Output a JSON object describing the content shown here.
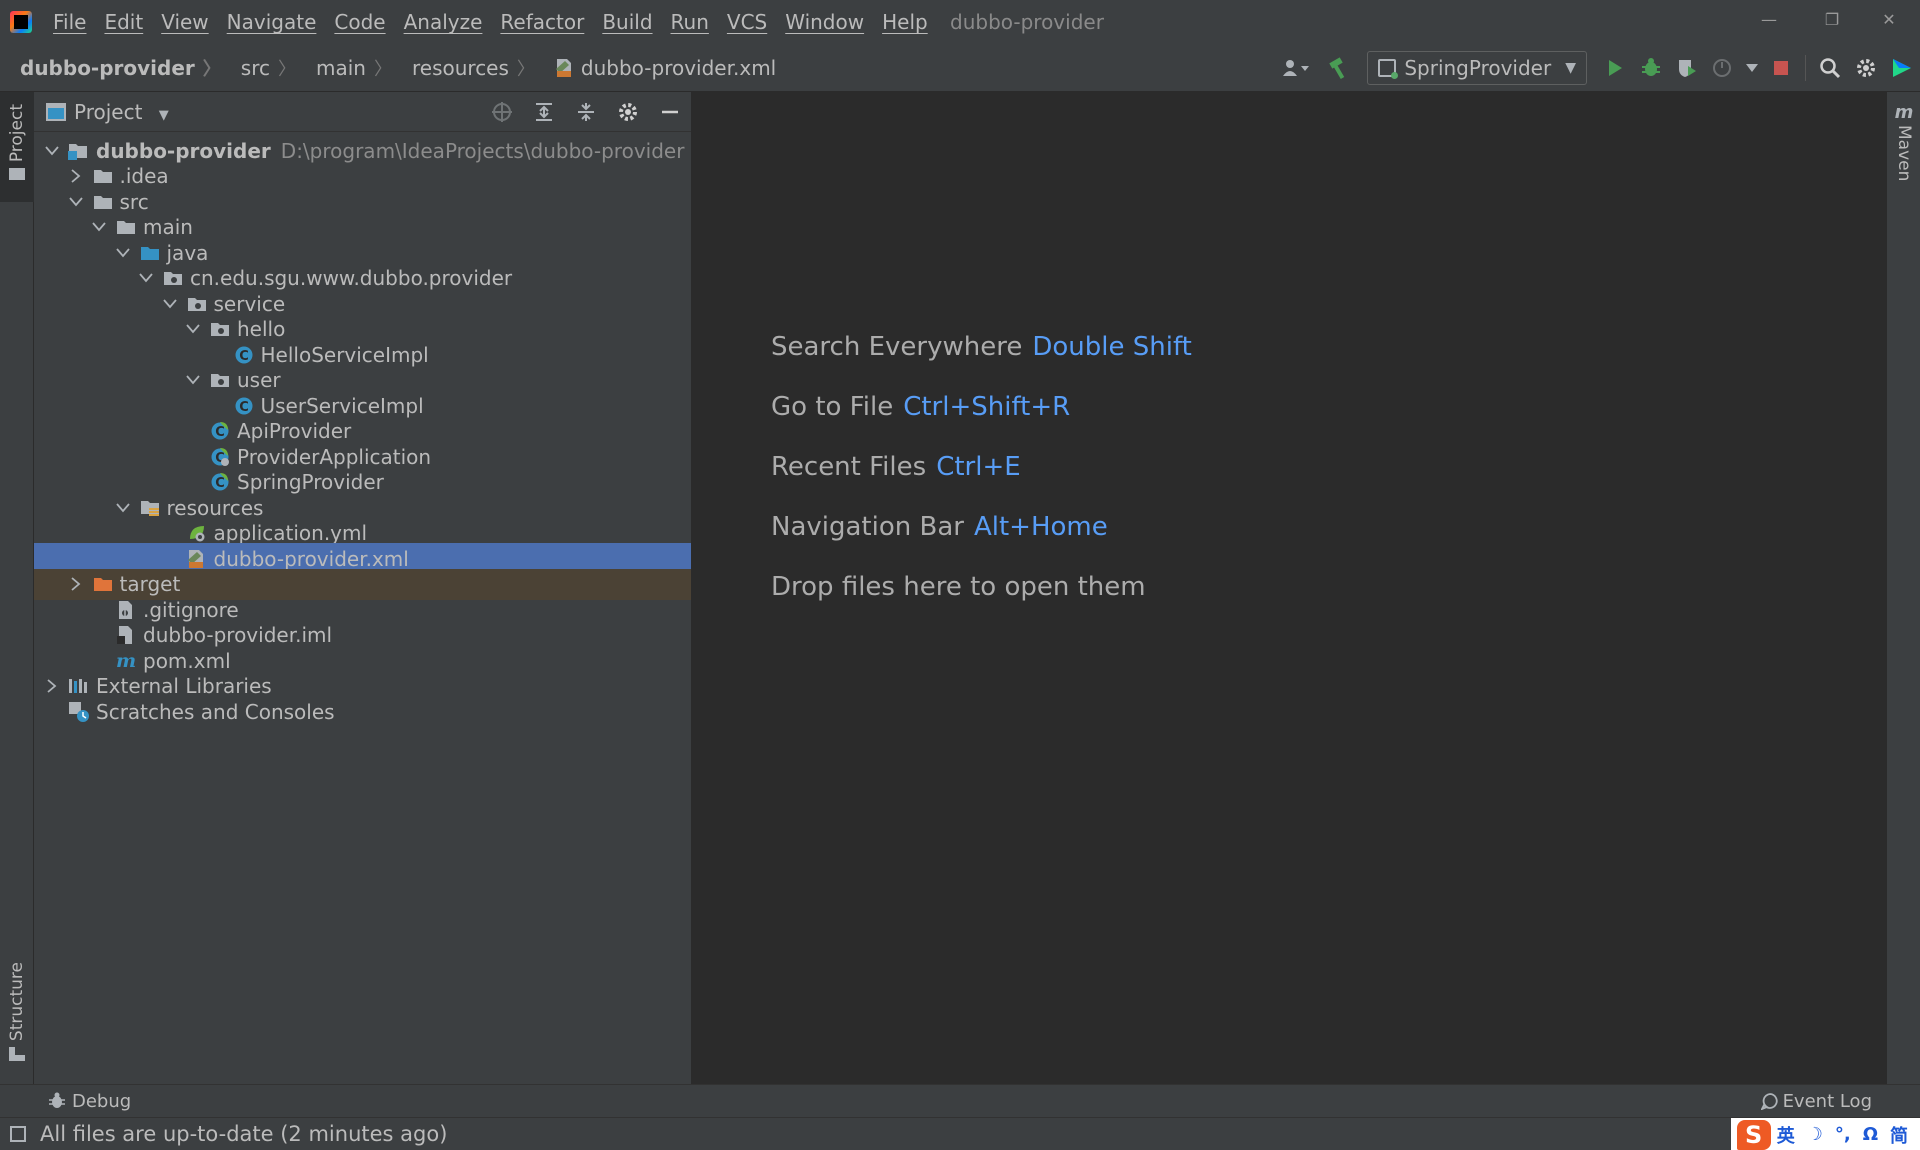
{
  "menu": {
    "items": [
      "File",
      "Edit",
      "View",
      "Navigate",
      "Code",
      "Analyze",
      "Refactor",
      "Build",
      "Run",
      "VCS",
      "Window",
      "Help"
    ],
    "window_title": "dubbo-provider"
  },
  "window_controls": {
    "minimize": "—",
    "restore": "❐",
    "close": "✕"
  },
  "breadcrumb": {
    "items": [
      "dubbo-provider",
      "src",
      "main",
      "resources",
      "dubbo-provider.xml"
    ],
    "separator": "〉"
  },
  "toolbar": {
    "run_config": "SpringProvider",
    "colors": {
      "run": "#499c54",
      "stop": "#c75450",
      "hammer": "#499c54"
    }
  },
  "side_tabs": {
    "project": "Project",
    "structure": "Structure",
    "maven": "Maven"
  },
  "project_panel": {
    "title": "Project",
    "tree": [
      {
        "label": "dubbo-provider",
        "hint": "D:\\program\\IdeaProjects\\dubbo-provider",
        "icon": "module-folder-icon",
        "depth": 0,
        "expanded": true,
        "bold": true
      },
      {
        "label": ".idea",
        "icon": "folder-icon",
        "depth": 1,
        "expanded": false
      },
      {
        "label": "src",
        "icon": "folder-icon",
        "depth": 1,
        "expanded": true
      },
      {
        "label": "main",
        "icon": "folder-icon",
        "depth": 2,
        "expanded": true
      },
      {
        "label": "java",
        "icon": "source-folder-icon",
        "depth": 3,
        "expanded": true
      },
      {
        "label": "cn.edu.sgu.www.dubbo.provider",
        "icon": "package-icon",
        "depth": 4,
        "expanded": true
      },
      {
        "label": "service",
        "icon": "package-icon",
        "depth": 5,
        "expanded": true
      },
      {
        "label": "hello",
        "icon": "package-icon",
        "depth": 6,
        "expanded": true
      },
      {
        "label": "HelloServiceImpl",
        "icon": "class-icon",
        "depth": 7
      },
      {
        "label": "user",
        "icon": "package-icon",
        "depth": 6,
        "expanded": true
      },
      {
        "label": "UserServiceImpl",
        "icon": "class-icon",
        "depth": 7
      },
      {
        "label": "ApiProvider",
        "icon": "spring-class-icon",
        "depth": 6
      },
      {
        "label": "ProviderApplication",
        "icon": "spring-boot-class-icon",
        "depth": 6
      },
      {
        "label": "SpringProvider",
        "icon": "spring-class-icon",
        "depth": 6
      },
      {
        "label": "resources",
        "icon": "resources-folder-icon",
        "depth": 3,
        "expanded": true
      },
      {
        "label": "application.yml",
        "icon": "yml-icon",
        "depth": 5
      },
      {
        "label": "dubbo-provider.xml",
        "icon": "xml-icon",
        "depth": 5,
        "selected": true
      },
      {
        "label": "target",
        "icon": "excluded-folder-icon",
        "depth": 1,
        "expanded": false,
        "excluded": true
      },
      {
        "label": ".gitignore",
        "icon": "gitignore-icon",
        "depth": 2
      },
      {
        "label": "dubbo-provider.iml",
        "icon": "iml-icon",
        "depth": 2
      },
      {
        "label": "pom.xml",
        "icon": "maven-icon",
        "depth": 2
      },
      {
        "label": "External Libraries",
        "icon": "libraries-icon",
        "depth": 0,
        "expanded": false
      },
      {
        "label": "Scratches and Consoles",
        "icon": "scratches-icon",
        "depth": 0
      }
    ]
  },
  "editor_hints": [
    {
      "action": "Search Everywhere",
      "shortcut": "Double Shift"
    },
    {
      "action": "Go to File",
      "shortcut": "Ctrl+Shift+R"
    },
    {
      "action": "Recent Files",
      "shortcut": "Ctrl+E"
    },
    {
      "action": "Navigation Bar",
      "shortcut": "Alt+Home"
    },
    {
      "action": "Drop files here to open them",
      "shortcut": ""
    }
  ],
  "bottom_tabs": {
    "debug": "Debug",
    "event_log": "Event Log"
  },
  "status": {
    "message": "All files are up-to-date (2 minutes ago)"
  },
  "ime": {
    "items": [
      "英",
      "☽",
      "°,",
      "Ω",
      "简"
    ]
  }
}
